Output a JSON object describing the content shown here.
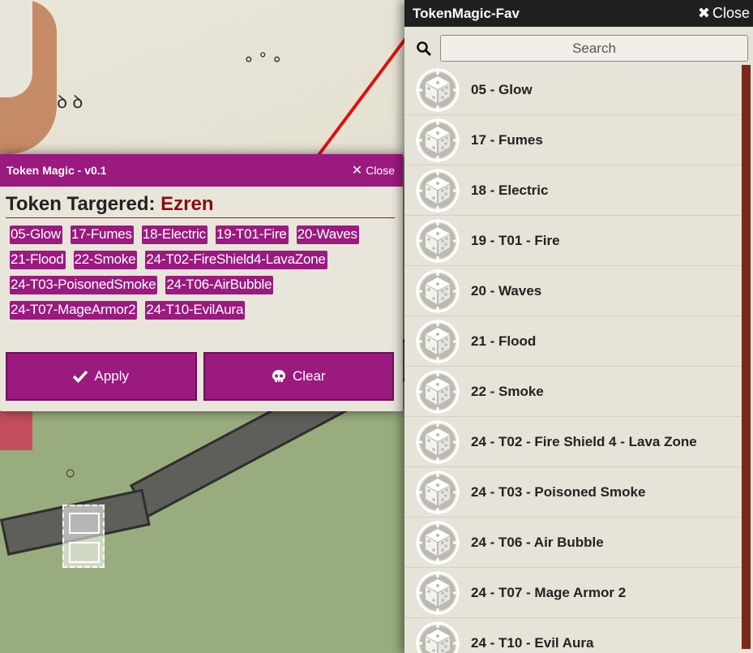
{
  "token_magic": {
    "title": "Token Magic - v0.1",
    "close_label": "Close",
    "heading": "Token Targered: ",
    "target_name": "Ezren",
    "tags": [
      "05-Glow",
      "17-Fumes",
      "18-Electric",
      "19-T01-Fire",
      "20-Waves",
      "21-Flood",
      "22-Smoke",
      "24-T02-FireShield4-LavaZone",
      "24-T03-PoisonedSmoke",
      "24-T06-AirBubble",
      "24-T07-MageArmor2",
      "24-T10-EvilAura"
    ],
    "apply_label": "Apply",
    "clear_label": "Clear"
  },
  "fav_panel": {
    "title": "TokenMagic-Fav",
    "close_label": "Close",
    "search_placeholder": "Search",
    "items": [
      "05 - Glow",
      "17 - Fumes",
      "18 - Electric",
      "19 - T01 - Fire",
      "20 - Waves",
      "21 - Flood",
      "22 - Smoke",
      "24 - T02 - Fire Shield 4 - Lava Zone",
      "24 - T03 - Poisoned Smoke",
      "24 - T06 - Air Bubble",
      "24 - T07 - Mage Armor 2",
      "24 - T10 - Evil Aura"
    ]
  },
  "colors": {
    "accent": "#9b1a7f",
    "target_name": "#8b0d0d",
    "arrow": "#e01010",
    "fav_header": "#202020"
  },
  "icons": {
    "item_icon": "dice-crosshair-icon",
    "apply_icon": "check-icon",
    "clear_icon": "skull-icon",
    "search_icon": "search-icon",
    "close_icon": "close-icon"
  }
}
